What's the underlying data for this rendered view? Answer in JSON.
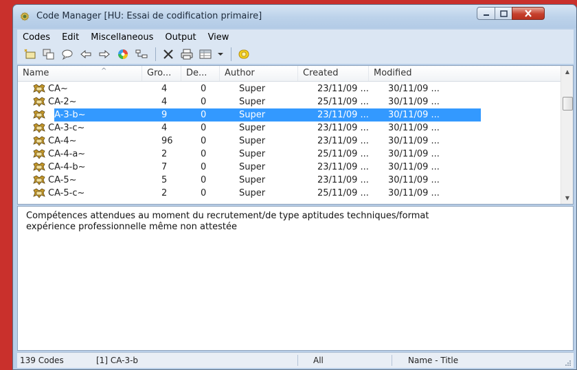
{
  "window": {
    "title": "Code Manager [HU: Essai de codification primaire]",
    "title_icon": "code-manager-icon"
  },
  "menu": [
    "Codes",
    "Edit",
    "Miscellaneous",
    "Output",
    "View"
  ],
  "toolbar": {
    "icons": [
      "new-code-icon",
      "copy-icon",
      "comment-icon",
      "back-arrow-icon",
      "forward-arrow-icon",
      "color-wheel-icon",
      "hierarchy-icon",
      "delete-icon",
      "print-icon",
      "table-icon",
      "dropdown-arrow-icon",
      "highlight-icon"
    ]
  },
  "list": {
    "columns": [
      "Name",
      "Gro...",
      "De...",
      "Author",
      "Created",
      "Modified"
    ],
    "rows": [
      {
        "name": "CA~",
        "gro": "4",
        "de": "0",
        "author": "Super",
        "created": "23/11/09 ...",
        "modified": "30/11/09 ..."
      },
      {
        "name": "CA-2~",
        "gro": "4",
        "de": "0",
        "author": "Super",
        "created": "25/11/09 ...",
        "modified": "30/11/09 ..."
      },
      {
        "name": "CA-3-b~",
        "gro": "9",
        "de": "0",
        "author": "Super",
        "created": "23/11/09 ...",
        "modified": "30/11/09 ..."
      },
      {
        "name": "CA-3-c~",
        "gro": "4",
        "de": "0",
        "author": "Super",
        "created": "23/11/09 ...",
        "modified": "30/11/09 ..."
      },
      {
        "name": "CA-4~",
        "gro": "96",
        "de": "0",
        "author": "Super",
        "created": "23/11/09 ...",
        "modified": "30/11/09 ..."
      },
      {
        "name": "CA-4-a~",
        "gro": "2",
        "de": "0",
        "author": "Super",
        "created": "25/11/09 ...",
        "modified": "30/11/09 ..."
      },
      {
        "name": "CA-4-b~",
        "gro": "7",
        "de": "0",
        "author": "Super",
        "created": "23/11/09 ...",
        "modified": "30/11/09 ..."
      },
      {
        "name": "CA-5~",
        "gro": "5",
        "de": "0",
        "author": "Super",
        "created": "23/11/09 ...",
        "modified": "30/11/09 ..."
      },
      {
        "name": "CA-5-c~",
        "gro": "2",
        "de": "0",
        "author": "Super",
        "created": "25/11/09 ...",
        "modified": "30/11/09 ..."
      }
    ],
    "selected_row": "CA-3-b~",
    "selection_color": "#3399ff"
  },
  "description": {
    "line1": "Compétences attendues au moment du recrutement/de type aptitudes techniques/format",
    "line2": "expérience professionnelle même non attestée"
  },
  "status": {
    "count": "139 Codes",
    "current": "[1] CA-3-b",
    "filter": "All",
    "sort": "Name - Title"
  },
  "colors": {
    "titlebar": "#bcd2ea",
    "menubar": "#dbe6f3",
    "background": "#c9302c"
  }
}
